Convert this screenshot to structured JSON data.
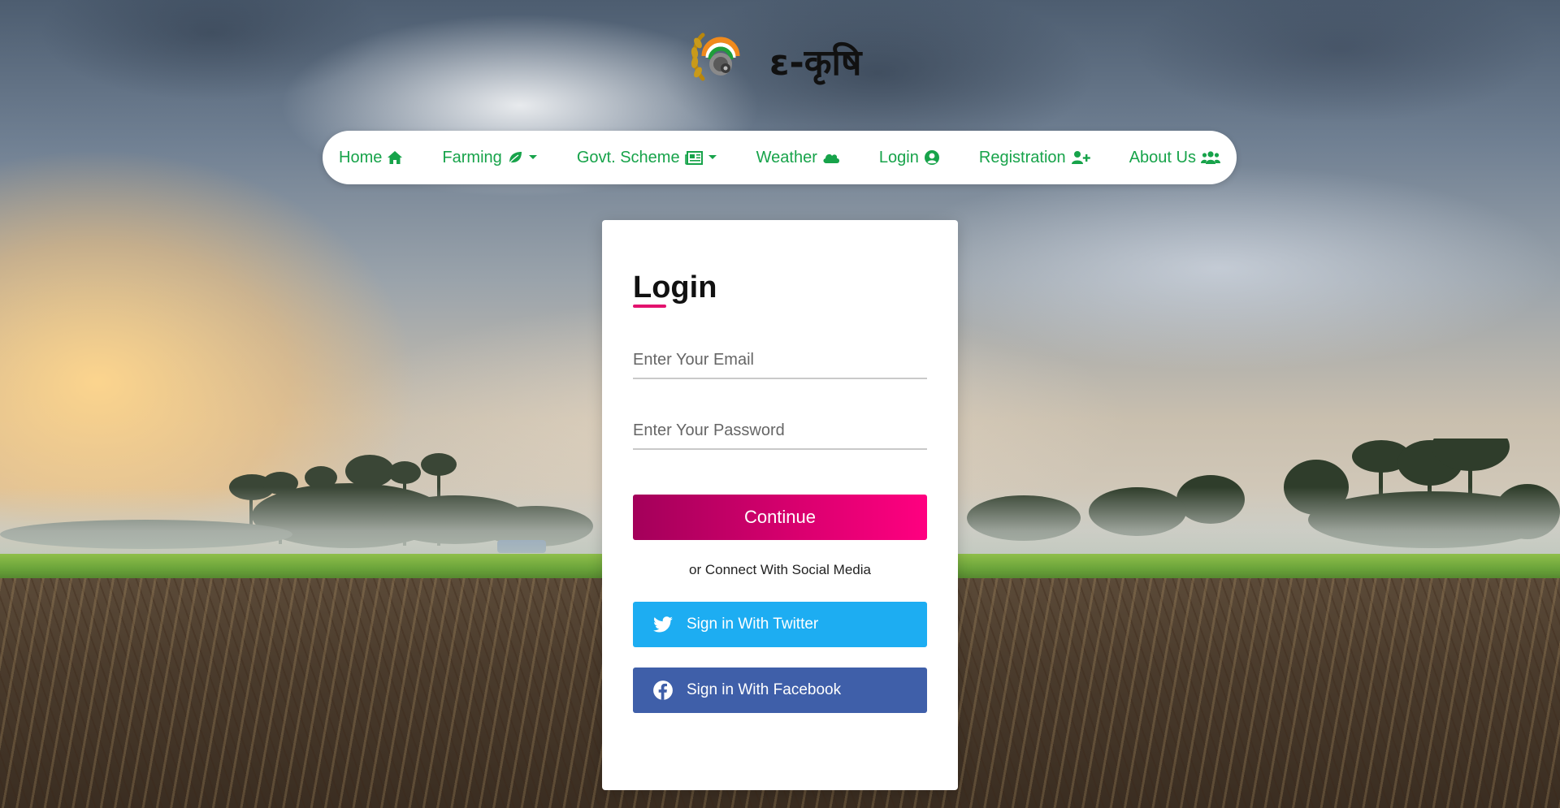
{
  "brand": {
    "name": "ε-कृषि",
    "logo_icon": "wheat-wreath-gear-emblem-icon"
  },
  "nav": {
    "items": [
      {
        "label": "Home",
        "icon": "home-icon"
      },
      {
        "label": "Farming",
        "icon": "leaf-icon",
        "dropdown": true
      },
      {
        "label": "Govt. Scheme",
        "icon": "newspaper-icon",
        "dropdown": true
      },
      {
        "label": "Weather",
        "icon": "cloud-icon"
      },
      {
        "label": "Login",
        "icon": "user-circle-icon"
      },
      {
        "label": "Registration",
        "icon": "user-plus-icon"
      },
      {
        "label": "About Us",
        "icon": "users-icon"
      }
    ],
    "color": "#17a34a"
  },
  "login": {
    "title": "Login",
    "email_placeholder": "Enter Your Email",
    "password_placeholder": "Enter Your Password",
    "continue_label": "Continue",
    "social_caption": "or Connect With Social Media",
    "twitter_label": "Sign in With Twitter",
    "facebook_label": "Sign in With Facebook"
  },
  "colors": {
    "accent_pink": "#e3126e",
    "twitter_blue": "#1dadf2",
    "facebook_blue": "#3f5fa9",
    "nav_green": "#17a34a"
  }
}
